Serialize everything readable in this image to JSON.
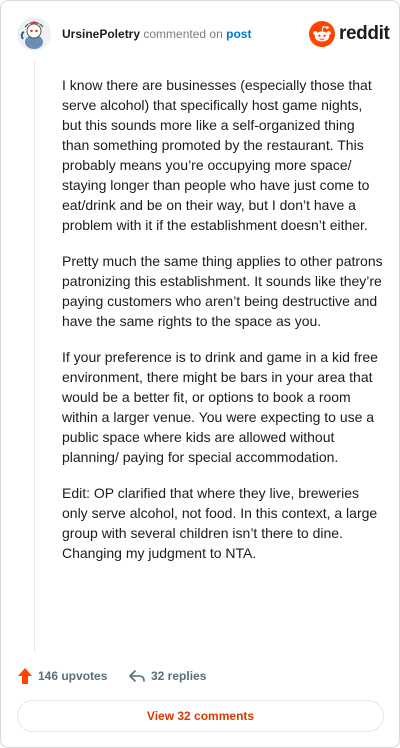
{
  "header": {
    "username": "UrsinePoletry",
    "action_text": "commented on",
    "post_link": "post",
    "brand": "reddit",
    "avatar_icon": "snoo-avatar-icon",
    "logo_icon": "reddit-logo-icon"
  },
  "comment": {
    "paragraphs": [
      "I know there are businesses (especially those that serve alcohol) that specifically host game nights, but this sounds more like a self-organized thing than something promoted by the restaurant. This probably means you’re occupying more space/ staying longer than people who have just come to eat/drink and be on their way, but I don’t have a problem with it if the establishment doesn’t either.",
      "Pretty much the same thing applies to other patrons patronizing this establishment. It sounds like they’re paying customers who aren’t being destructive and have the same rights to the space as you.",
      "If your preference is to drink and game in a kid free environment, there might be bars in your area that would be a better fit, or options to book a room within a larger venue. You were expecting to use a public space where kids are allowed without planning/ paying for special accommodation.",
      "Edit: OP clarified that where they live, breweries only serve alcohol, not food. In this context, a large group with several children isn’t there to dine. Changing my judgment to NTA."
    ]
  },
  "actions": {
    "upvotes_label": "146 upvotes",
    "replies_label": "32 replies",
    "upvote_icon": "upvote-arrow-icon",
    "reply_icon": "reply-arrow-icon"
  },
  "footer": {
    "view_comments_label": "View 32 comments"
  },
  "colors": {
    "accent": "#ff4500",
    "link": "#0079d3",
    "button_text": "#d93a00",
    "muted": "#576f76"
  }
}
